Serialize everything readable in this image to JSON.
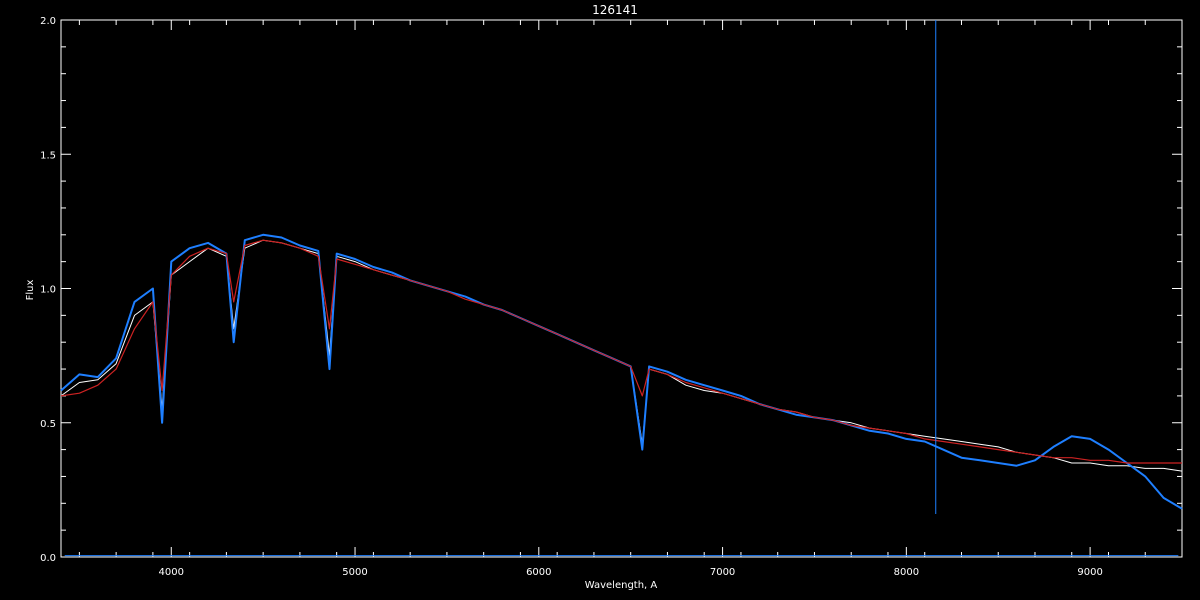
{
  "chart_data": {
    "type": "line",
    "title": "126141",
    "xlabel": "Wavelength, A",
    "ylabel": "Flux",
    "xlim": [
      3400,
      9500
    ],
    "ylim": [
      0.0,
      2.0
    ],
    "x_ticks": [
      4000,
      5000,
      6000,
      7000,
      8000,
      9000
    ],
    "x_tick_labels": [
      "4000",
      "5000",
      "6000",
      "7000",
      "8000",
      "9000"
    ],
    "y_ticks": [
      0.0,
      0.5,
      1.0,
      1.5,
      2.0
    ],
    "y_tick_labels": [
      "0.0",
      "0.5",
      "1.0",
      "1.5",
      "2.0"
    ],
    "grid": false,
    "colors": {
      "background": "#000000",
      "axes": "#ffffff",
      "observed": "#ffffff",
      "model": "#1e7fff",
      "fit": "#cc2222",
      "marker_line": "#1e7fff"
    },
    "vertical_line_x": 8160,
    "series": [
      {
        "key": "observed",
        "x": [
          3400,
          3500,
          3600,
          3700,
          3800,
          3900,
          3950,
          4000,
          4100,
          4200,
          4300,
          4340,
          4400,
          4500,
          4600,
          4700,
          4800,
          4861,
          4900,
          5000,
          5100,
          5200,
          5300,
          5400,
          5500,
          5600,
          5700,
          5800,
          5900,
          6000,
          6100,
          6200,
          6300,
          6400,
          6500,
          6563,
          6600,
          6700,
          6800,
          6900,
          7000,
          7100,
          7200,
          7300,
          7400,
          7500,
          7600,
          7700,
          7800,
          7900,
          8000,
          8100,
          8200,
          8300,
          8400,
          8500,
          8600,
          8700,
          8800,
          8900,
          9000,
          9100,
          9200,
          9300,
          9400,
          9500
        ],
        "y": [
          0.6,
          0.65,
          0.66,
          0.72,
          0.9,
          0.95,
          0.55,
          1.05,
          1.1,
          1.15,
          1.12,
          0.85,
          1.15,
          1.18,
          1.17,
          1.15,
          1.13,
          0.75,
          1.12,
          1.1,
          1.07,
          1.05,
          1.03,
          1.01,
          0.99,
          0.97,
          0.94,
          0.92,
          0.89,
          0.86,
          0.83,
          0.8,
          0.77,
          0.74,
          0.71,
          0.42,
          0.7,
          0.68,
          0.64,
          0.62,
          0.61,
          0.59,
          0.57,
          0.55,
          0.54,
          0.52,
          0.51,
          0.5,
          0.48,
          0.47,
          0.46,
          0.45,
          0.44,
          0.43,
          0.42,
          0.41,
          0.39,
          0.38,
          0.37,
          0.35,
          0.35,
          0.34,
          0.34,
          0.33,
          0.33,
          0.32
        ]
      },
      {
        "key": "model",
        "x": [
          3400,
          3500,
          3600,
          3700,
          3800,
          3900,
          3950,
          4000,
          4100,
          4200,
          4300,
          4340,
          4400,
          4500,
          4600,
          4700,
          4800,
          4861,
          4900,
          5000,
          5100,
          5200,
          5300,
          5400,
          5500,
          5600,
          5700,
          5800,
          5900,
          6000,
          6100,
          6200,
          6300,
          6400,
          6500,
          6563,
          6600,
          6700,
          6800,
          6900,
          7000,
          7100,
          7200,
          7300,
          7400,
          7500,
          7600,
          7700,
          7800,
          7900,
          8000,
          8100,
          8200,
          8300,
          8400,
          8500,
          8600,
          8700,
          8800,
          8900,
          9000,
          9100,
          9200,
          9300,
          9400,
          9500
        ],
        "y": [
          0.62,
          0.68,
          0.67,
          0.74,
          0.95,
          1.0,
          0.5,
          1.1,
          1.15,
          1.17,
          1.13,
          0.8,
          1.18,
          1.2,
          1.19,
          1.16,
          1.14,
          0.7,
          1.13,
          1.11,
          1.08,
          1.06,
          1.03,
          1.01,
          0.99,
          0.97,
          0.94,
          0.92,
          0.89,
          0.86,
          0.83,
          0.8,
          0.77,
          0.74,
          0.71,
          0.4,
          0.71,
          0.69,
          0.66,
          0.64,
          0.62,
          0.6,
          0.57,
          0.55,
          0.53,
          0.52,
          0.51,
          0.49,
          0.47,
          0.46,
          0.44,
          0.43,
          0.4,
          0.37,
          0.36,
          0.35,
          0.34,
          0.36,
          0.41,
          0.45,
          0.44,
          0.4,
          0.35,
          0.3,
          0.22,
          0.18
        ]
      },
      {
        "key": "fit",
        "x": [
          3400,
          3500,
          3600,
          3700,
          3800,
          3900,
          3950,
          4000,
          4100,
          4200,
          4300,
          4340,
          4400,
          4500,
          4600,
          4700,
          4800,
          4861,
          4900,
          5000,
          5100,
          5200,
          5300,
          5400,
          5500,
          5600,
          5700,
          5800,
          5900,
          6000,
          6100,
          6200,
          6300,
          6400,
          6500,
          6563,
          6600,
          6700,
          6800,
          6900,
          7000,
          7100,
          7200,
          7300,
          7400,
          7500,
          7600,
          7700,
          7800,
          7900,
          8000,
          8100,
          8200,
          8300,
          8400,
          8500,
          8600,
          8700,
          8800,
          8900,
          9000,
          9100,
          9200,
          9300,
          9400,
          9500
        ],
        "y": [
          0.6,
          0.61,
          0.64,
          0.7,
          0.85,
          0.95,
          0.62,
          1.05,
          1.12,
          1.15,
          1.13,
          0.95,
          1.16,
          1.18,
          1.17,
          1.15,
          1.12,
          0.85,
          1.11,
          1.09,
          1.07,
          1.05,
          1.03,
          1.01,
          0.99,
          0.96,
          0.94,
          0.92,
          0.89,
          0.86,
          0.83,
          0.8,
          0.77,
          0.74,
          0.71,
          0.6,
          0.7,
          0.68,
          0.65,
          0.63,
          0.61,
          0.59,
          0.57,
          0.55,
          0.54,
          0.52,
          0.51,
          0.49,
          0.48,
          0.47,
          0.46,
          0.44,
          0.43,
          0.42,
          0.41,
          0.4,
          0.39,
          0.38,
          0.37,
          0.37,
          0.36,
          0.36,
          0.35,
          0.35,
          0.35,
          0.35
        ]
      }
    ]
  }
}
